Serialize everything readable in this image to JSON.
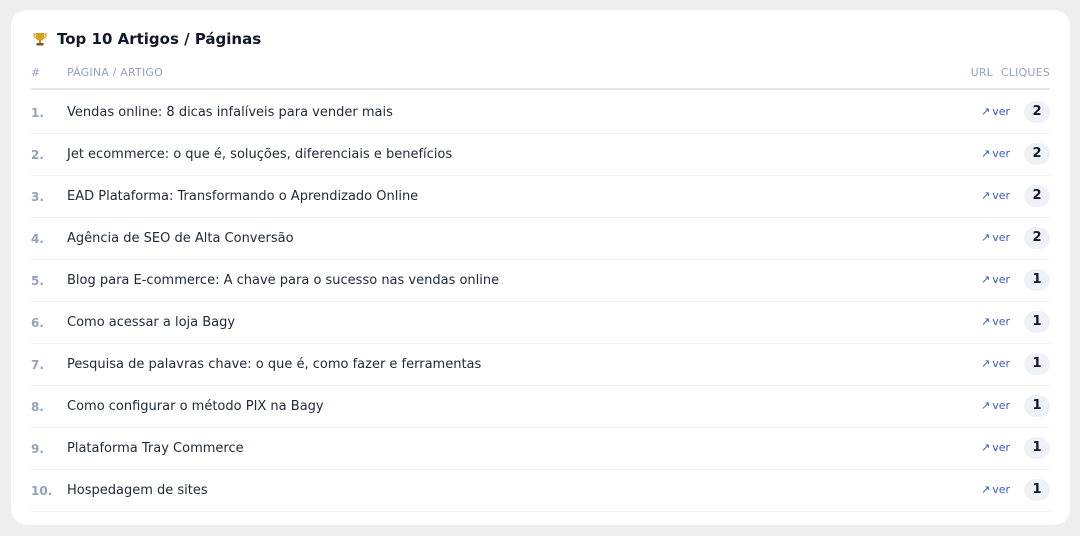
{
  "card": {
    "title": "Top 10 Artigos / Páginas",
    "icon": "trophy-icon"
  },
  "table": {
    "headers": {
      "num": "#",
      "page": "PÁGINA / ARTIGO",
      "url": "URL",
      "clicks": "CLIQUES"
    },
    "link_label": "ver",
    "link_arrow": "↗",
    "rows": [
      {
        "num": "1.",
        "page": "Vendas online: 8 dicas infalíveis para vender mais",
        "clicks": "2"
      },
      {
        "num": "2.",
        "page": "Jet ecommerce: o que é, soluções, diferenciais e benefícios",
        "clicks": "2"
      },
      {
        "num": "3.",
        "page": "EAD Plataforma: Transformando o Aprendizado Online",
        "clicks": "2"
      },
      {
        "num": "4.",
        "page": "Agência de SEO de Alta Conversão",
        "clicks": "2"
      },
      {
        "num": "5.",
        "page": "Blog para E-commerce: A chave para o sucesso nas vendas online",
        "clicks": "1"
      },
      {
        "num": "6.",
        "page": "Como acessar a loja Bagy",
        "clicks": "1"
      },
      {
        "num": "7.",
        "page": "Pesquisa de palavras chave: o que é, como fazer e ferramentas",
        "clicks": "1"
      },
      {
        "num": "8.",
        "page": "Como configurar o método PIX na Bagy",
        "clicks": "1"
      },
      {
        "num": "9.",
        "page": "Plataforma Tray Commerce",
        "clicks": "1"
      },
      {
        "num": "10.",
        "page": "Hospedagem de sites",
        "clicks": "1"
      }
    ]
  },
  "colors": {
    "link": "#3b5bb5",
    "muted": "#94a3b8",
    "badge_bg": "#eef1f6",
    "trophy": "#d6a21e"
  }
}
